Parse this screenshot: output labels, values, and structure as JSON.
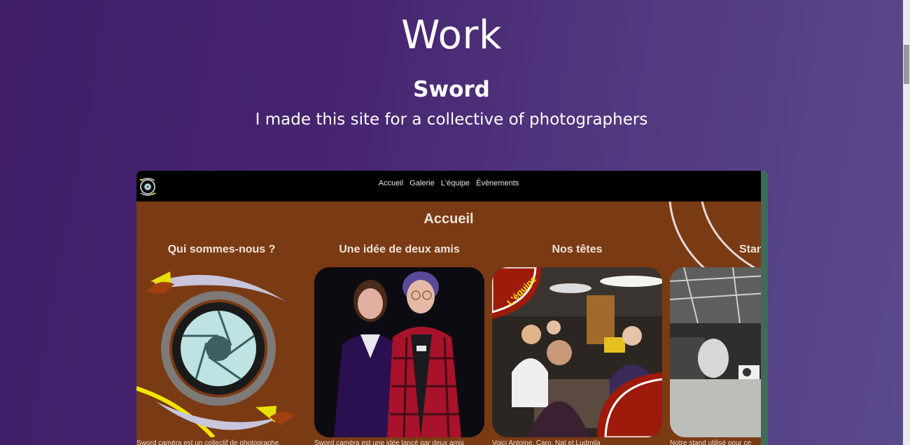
{
  "page": {
    "title": "Work"
  },
  "project": {
    "title": "Sword",
    "description": "I made this site for a collective of photographers"
  },
  "preview": {
    "nav": {
      "items": [
        "Accueil",
        "Galerie",
        "L'équipe",
        "Évènements"
      ]
    },
    "heading": "Accueil",
    "cards": [
      {
        "title": "Qui sommes-nous ?",
        "caption": "Sword caméra est un collectif de photographe",
        "icon": "aperture-logo"
      },
      {
        "title": "Une idée de deux amis",
        "caption": "Sword caméra est une idée lancé par deux amis",
        "icon": "two-friends-photo"
      },
      {
        "title": "Nos têtes",
        "caption": "Voici Antoine, Caro, Nat et Ludmila",
        "badge": "L'équipe",
        "icon": "team-photo"
      },
      {
        "title": "Stand",
        "caption": "Notre stand utilisé pour ce",
        "icon": "stand-photo"
      }
    ],
    "colors": {
      "nav_bg": "#000000",
      "content_bg": "#7a3a14",
      "accent_red": "#9e1a0a",
      "accent_yellow": "#f2e600"
    }
  }
}
